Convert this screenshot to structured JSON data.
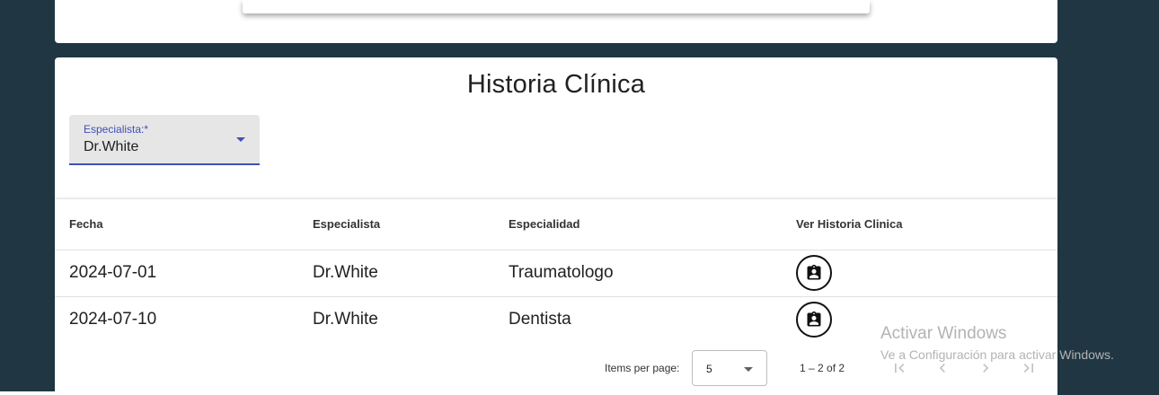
{
  "page": {
    "title": "Historia Clínica"
  },
  "filter": {
    "label": "Especialista:*",
    "selected": "Dr.White"
  },
  "table": {
    "columns": [
      "Fecha",
      "Especialista",
      "Especialidad",
      "Ver Historia Clinica"
    ],
    "rows": [
      {
        "fecha": "2024-07-01",
        "especialista": "Dr.White",
        "especialidad": "Traumatologo",
        "action_icon": "clipboard-account-icon"
      },
      {
        "fecha": "2024-07-10",
        "especialista": "Dr.White",
        "especialidad": "Dentista",
        "action_icon": "clipboard-account-icon"
      }
    ]
  },
  "paginator": {
    "items_per_page_label": "Items per page:",
    "page_size": "5",
    "range": "1 – 2 of 2",
    "buttons": [
      "first-page-icon",
      "previous-page-icon",
      "next-page-icon",
      "last-page-icon"
    ]
  },
  "watermark": {
    "title": "Activar Windows",
    "subtitle": "Ve a Configuración para activar Windows."
  },
  "colors": {
    "background": "#203743",
    "accent": "#3f51b5",
    "card": "#ffffff"
  }
}
